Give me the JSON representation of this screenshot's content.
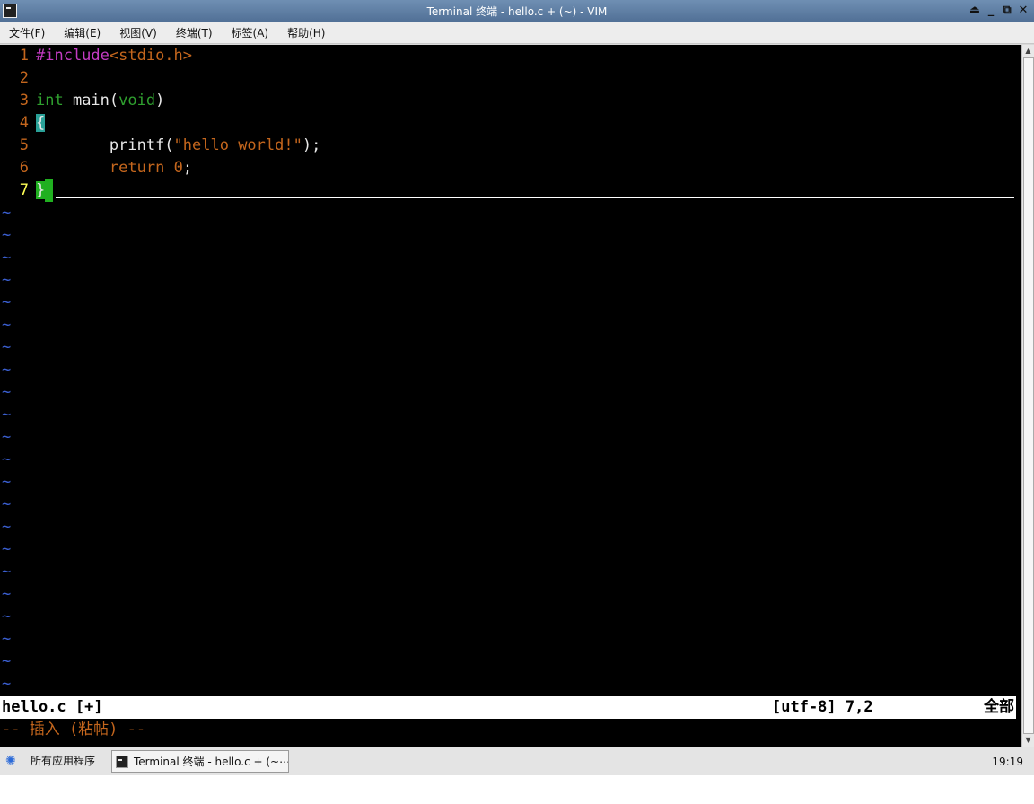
{
  "window": {
    "title": "Terminal 终端 - hello.c + (~) - VIM",
    "buttons": [
      "⏏",
      "_",
      "⧉",
      "✕"
    ]
  },
  "menu": [
    "文件(F)",
    "编辑(E)",
    "视图(V)",
    "终端(T)",
    "标签(A)",
    "帮助(H)"
  ],
  "editor": {
    "lines": [
      {
        "n": "1"
      },
      {
        "n": "2"
      },
      {
        "n": "3"
      },
      {
        "n": "4"
      },
      {
        "n": "5"
      },
      {
        "n": "6"
      },
      {
        "n": "7"
      }
    ],
    "code": {
      "l1_pp": "#include",
      "l1_hdr": "<stdio.h>",
      "l3_type": "int",
      "l3_main": " main(",
      "l3_void": "void",
      "l3_close": ")",
      "l4_brace": "{",
      "l5_indent": "        ",
      "l5_fn": "printf(",
      "l5_str": "\"hello world!\"",
      "l5_end": ");",
      "l6_indent": "        ",
      "l6_kw": "return",
      "l6_sp": " ",
      "l6_num": "0",
      "l6_end": ";",
      "l7_brace": "}"
    },
    "tilde": "~",
    "tilde_count": 22
  },
  "status": {
    "filename": "hello.c [+]",
    "encoding_pos": "[utf-8] 7,2",
    "scroll": "全部",
    "mode": "-- 插入 (粘帖) --"
  },
  "taskbar": {
    "start_label": "所有应用程序",
    "task_label": "Terminal 终端 - hello.c + (~⋯",
    "clock": "19:19"
  }
}
